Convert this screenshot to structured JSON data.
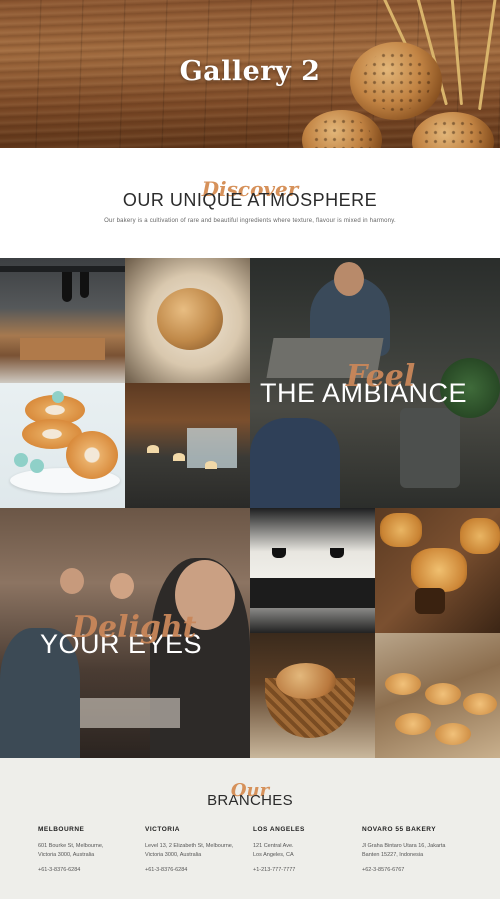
{
  "hero": {
    "title": "Gallery 2"
  },
  "discover": {
    "script": "Discover",
    "heading": "OUR UNIQUE ATMOSPHERE",
    "text": "Our bakery is a cultivation of rare and beautiful ingredients where texture, flavour is mixed in harmony."
  },
  "gallery": {
    "ambiance": {
      "script": "Feel",
      "big": "THE AMBIANCE"
    },
    "eyes": {
      "script": "Delight",
      "big": "YOUR EYES"
    },
    "photos": [
      "bakery-interior",
      "bread-loaf",
      "barista-tray",
      "donuts",
      "cafe-hall",
      "crowd-dining",
      "kitchen-counter",
      "mooncakes",
      "bread-basket",
      "pastries-tray"
    ]
  },
  "branches": {
    "script": "Our",
    "heading": "BRANCHES",
    "items": [
      {
        "city": "MELBOURNE",
        "addr1": "601 Bourke St, Melbourne,",
        "addr2": "Victoria 3000, Australia",
        "tel": "+61-3-8376-6284"
      },
      {
        "city": "VICTORIA",
        "addr1": "Level 13, 2 Elizabeth St, Melbourne,",
        "addr2": "Victoria 3000, Australia",
        "tel": "+61-3-8376-6284"
      },
      {
        "city": "LOS ANGELES",
        "addr1": "121 Central Ave.",
        "addr2": "Los Angeles, CA",
        "tel": "+1-213-777-7777"
      },
      {
        "city": "NOVARO 55 BAKERY",
        "addr1": "Jl Graha Bintaro Utara 16, Jakarta",
        "addr2": "Banten 15227, Indonesia",
        "tel": "+62-3-8576-6767"
      }
    ]
  }
}
